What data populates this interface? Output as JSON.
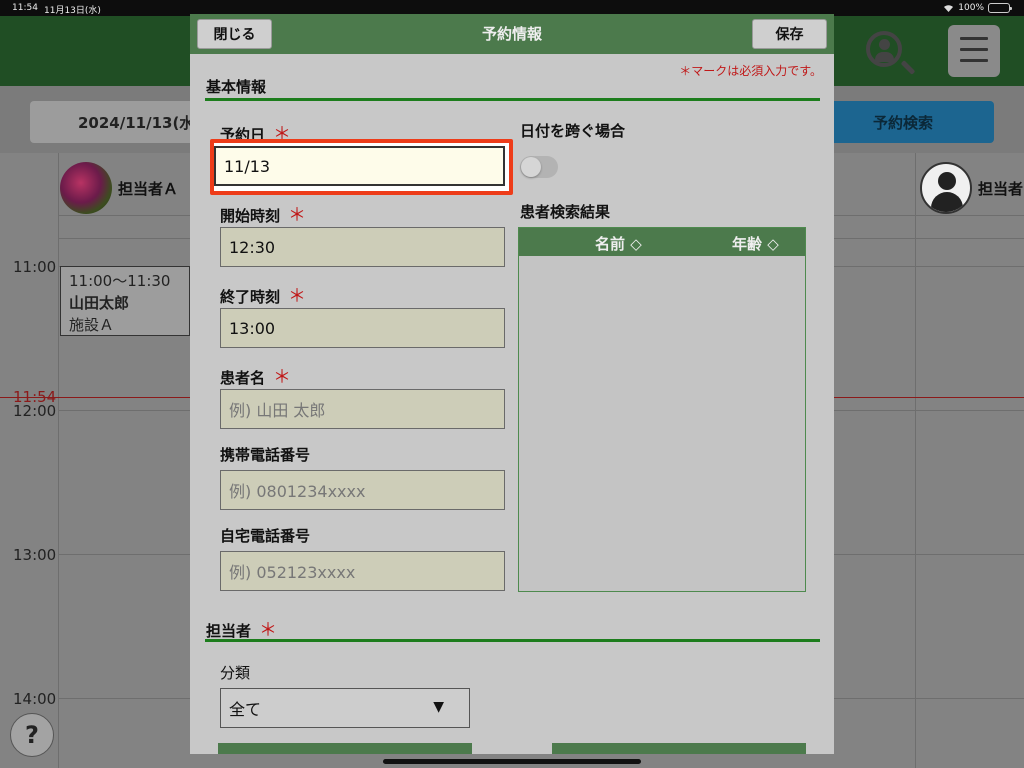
{
  "status": {
    "time": "11:54",
    "date": "11月13日(水)",
    "battery": "100%"
  },
  "app": {
    "date_display": "2024/11/13(水",
    "search_button": "予約検索",
    "staff": [
      {
        "name": "担当者Ａ"
      },
      {
        "name": "担当者"
      }
    ],
    "times": [
      "11:00",
      "12:00",
      "13:00",
      "14:00"
    ],
    "now_label": "11:54",
    "appointment": {
      "time": "11:00～11:30",
      "name": "山田太郎",
      "place": "施設Ａ"
    },
    "help": "?"
  },
  "modal": {
    "title": "予約情報",
    "close": "閉じる",
    "save": "保存",
    "required_note": "＊マークは必須入力です。",
    "required_mark": "＊",
    "basic_section": "基本情報",
    "date_label": "予約日",
    "date_value": "11/13",
    "cross_day_label": "日付を跨ぐ場合",
    "cross_day_on": false,
    "start_label": "開始時刻",
    "start_value": "12:30",
    "end_label": "終了時刻",
    "end_value": "13:00",
    "patient_label": "患者名",
    "patient_placeholder": "例) 山田 太郎",
    "mobile_label": "携帯電話番号",
    "mobile_placeholder": "例) 0801234xxxx",
    "home_label": "自宅電話番号",
    "home_placeholder": "例) 052123xxxx",
    "results_label": "患者検索結果",
    "results_col_name": "名前 ◇",
    "results_col_age": "年齢 ◇",
    "staff_section": "担当者",
    "category_label": "分類",
    "category_value": "全て",
    "category_arrow": "▼"
  },
  "colors": {
    "accent_green": "#1d7d1d",
    "required_red": "#c01818",
    "focus_orange": "#ee3c19"
  }
}
